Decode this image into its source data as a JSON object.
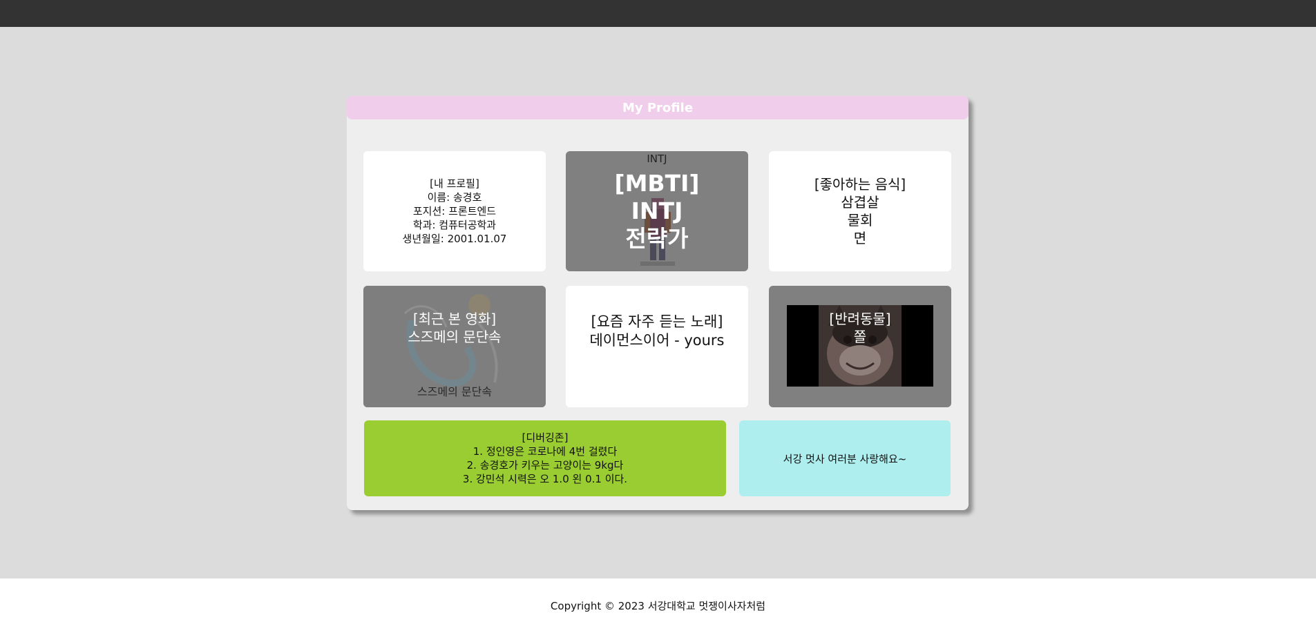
{
  "card": {
    "title": "My Profile"
  },
  "profile": {
    "lines": [
      "[내 프로필]",
      "이름: 송경호",
      "포지션: 프론트엔드",
      "학과: 컴퓨터공학과",
      "생년월일: 2001.01.07"
    ]
  },
  "mbti": {
    "caption": "INTJ",
    "lines": [
      "[MBTI]",
      "INTJ",
      "전략가"
    ]
  },
  "food": {
    "lines": [
      "[좋아하는 음식]",
      "삼겹살",
      "물회",
      "면"
    ]
  },
  "movie": {
    "lines": [
      "[최근 본 영화]",
      "스즈메의 문단속"
    ],
    "poster_title": "스즈메의 문단속"
  },
  "song": {
    "lines": [
      "[요즘 자주 듣는 노래]",
      "데이먼스이어 - yours"
    ]
  },
  "pet": {
    "lines": [
      "[반려동물]",
      "쫄"
    ]
  },
  "debug": {
    "lines": [
      "[디버깅존]",
      "1. 정인영은 코로나에 4번 걸렸다",
      "2. 송경호가 키우는 고양이는 9kg다",
      "3. 강민석 시력은 오 1.0 왼 0.1 이다."
    ]
  },
  "message": {
    "text": "서강 멋사 여러분 사랑해요~"
  },
  "footer": {
    "text": "Copyright © 2023 서강대학교 멋쟁이사자처럼"
  },
  "colors": {
    "topbar": "#333333",
    "background": "#dcdcdc",
    "header": "#f0cdea",
    "debug_tile": "#9acd32",
    "message_tile": "#afeeee",
    "dim_tile": "#808080"
  }
}
